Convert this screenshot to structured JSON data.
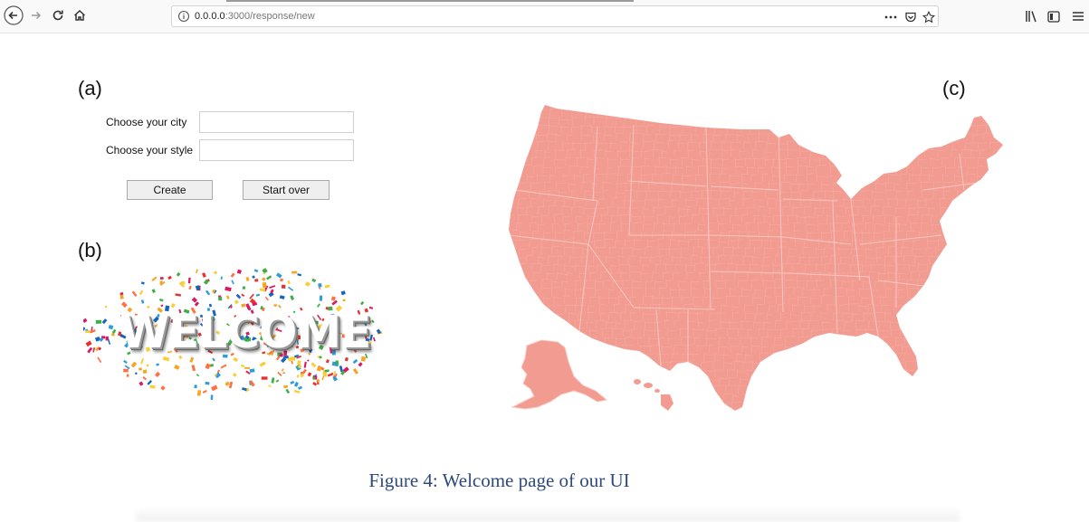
{
  "browser": {
    "url_host": "0.0.0.0",
    "url_rest": ":3000/response/new",
    "icons": {
      "back": "back-arrow-icon",
      "forward": "forward-arrow-icon",
      "reload": "reload-icon",
      "home": "home-icon",
      "info": "info-icon",
      "page_actions": "more-dots-icon",
      "pocket": "pocket-icon",
      "bookmark": "star-icon",
      "library": "library-icon",
      "sidebar": "sidebar-icon",
      "menu": "hamburger-menu-icon"
    }
  },
  "panels": {
    "a_label": "(a)",
    "b_label": "(b)",
    "c_label": "(c)"
  },
  "form": {
    "city_label": "Choose your city",
    "city_value": "",
    "style_label": "Choose your style",
    "style_value": "",
    "create_label": "Create",
    "start_over_label": "Start over"
  },
  "welcome": {
    "text": "WELCOME"
  },
  "map": {
    "fill_color": "#f29b91",
    "border_color": "#f8c7c0"
  },
  "caption": "Figure 4: Welcome page of our UI",
  "colors": {
    "caption": "#2e4a7a",
    "confetti": [
      "#e8312d",
      "#f5a623",
      "#2d9cdb",
      "#d81b60",
      "#f7d038",
      "#3fae49",
      "#1565c0",
      "#ff7043"
    ]
  }
}
